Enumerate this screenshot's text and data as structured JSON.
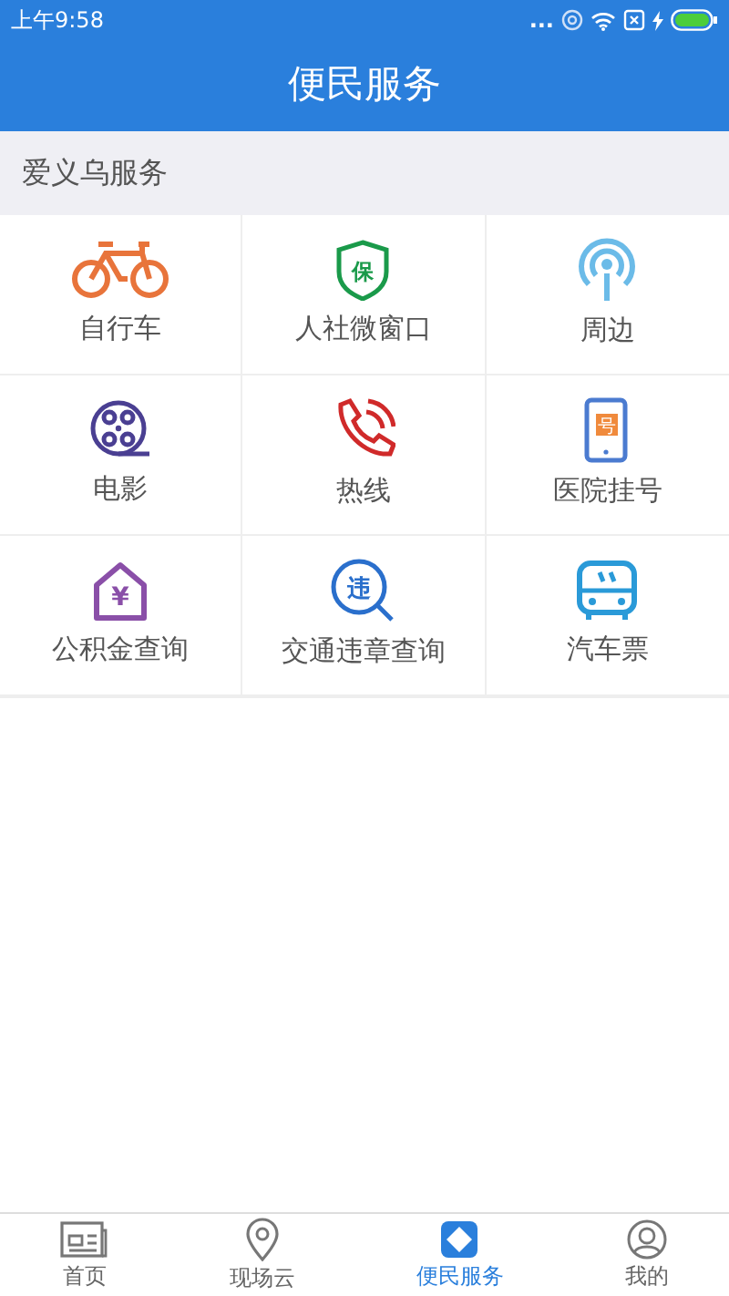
{
  "status_bar": {
    "time": "上午9:58",
    "dots": "..."
  },
  "header": {
    "title": "便民服务"
  },
  "section": {
    "title": "爱义乌服务"
  },
  "services": [
    {
      "label": "自行车",
      "kind": "bike"
    },
    {
      "label": "人社微窗口",
      "kind": "shield",
      "icon_text": "保"
    },
    {
      "label": "周边",
      "kind": "signal"
    },
    {
      "label": "电影",
      "kind": "film"
    },
    {
      "label": "热线",
      "kind": "phone"
    },
    {
      "label": "医院挂号",
      "kind": "mobile",
      "icon_text": "号"
    },
    {
      "label": "公积金查询",
      "kind": "house",
      "icon_text": "¥"
    },
    {
      "label": "交通违章查询",
      "kind": "search",
      "icon_text": "违"
    },
    {
      "label": "汽车票",
      "kind": "bus"
    }
  ],
  "tabs": [
    {
      "label": "首页",
      "kind": "news",
      "selected": false
    },
    {
      "label": "现场云",
      "kind": "pin",
      "selected": false
    },
    {
      "label": "便民服务",
      "kind": "diamond",
      "selected": true
    },
    {
      "label": "我的",
      "kind": "user",
      "selected": false
    }
  ]
}
